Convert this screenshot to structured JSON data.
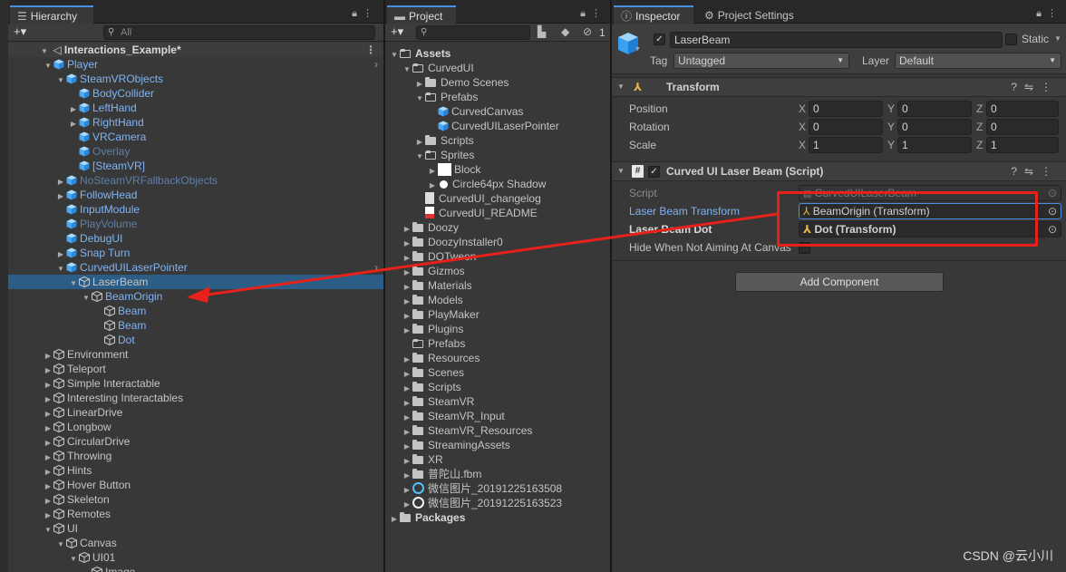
{
  "hierarchy": {
    "tab_title": "Hierarchy",
    "search_placeholder": "All",
    "add_label": "+▾",
    "scene_name": "Interactions_Example*",
    "rows": [
      {
        "label": "Player",
        "depth": 1,
        "tri": "open",
        "style": "blue",
        "icon": "prefab"
      },
      {
        "label": "SteamVRObjects",
        "depth": 2,
        "tri": "open",
        "style": "blue",
        "icon": "prefab"
      },
      {
        "label": "BodyCollider",
        "depth": 3,
        "tri": "",
        "style": "blue",
        "icon": "prefab"
      },
      {
        "label": "LeftHand",
        "depth": 3,
        "tri": "closed",
        "style": "blue",
        "icon": "prefab"
      },
      {
        "label": "RightHand",
        "depth": 3,
        "tri": "closed",
        "style": "blue",
        "icon": "prefab"
      },
      {
        "label": "VRCamera",
        "depth": 3,
        "tri": "",
        "style": "blue",
        "icon": "prefab"
      },
      {
        "label": "Overlay",
        "depth": 3,
        "tri": "",
        "style": "dim",
        "icon": "prefab"
      },
      {
        "label": "[SteamVR]",
        "depth": 3,
        "tri": "",
        "style": "blue",
        "icon": "prefab"
      },
      {
        "label": "NoSteamVRFallbackObjects",
        "depth": 2,
        "tri": "closed",
        "style": "dim",
        "icon": "prefab"
      },
      {
        "label": "FollowHead",
        "depth": 2,
        "tri": "closed",
        "style": "blue",
        "icon": "prefab"
      },
      {
        "label": "InputModule",
        "depth": 2,
        "tri": "",
        "style": "blue",
        "icon": "prefab"
      },
      {
        "label": "PlayVolume",
        "depth": 2,
        "tri": "",
        "style": "dim",
        "icon": "prefab"
      },
      {
        "label": "DebugUI",
        "depth": 2,
        "tri": "",
        "style": "blue",
        "icon": "prefab"
      },
      {
        "label": "Snap Turn",
        "depth": 2,
        "tri": "closed",
        "style": "blue",
        "icon": "prefab"
      },
      {
        "label": "CurvedUILaserPointer",
        "depth": 2,
        "tri": "open",
        "style": "blue",
        "icon": "prefab"
      },
      {
        "label": "LaserBeam",
        "depth": 3,
        "tri": "open",
        "style": "lbl",
        "icon": "go",
        "selected": true
      },
      {
        "label": "BeamOrigin",
        "depth": 4,
        "tri": "open",
        "style": "blue",
        "icon": "go"
      },
      {
        "label": "Beam",
        "depth": 5,
        "tri": "",
        "style": "blue",
        "icon": "go"
      },
      {
        "label": "Beam",
        "depth": 5,
        "tri": "",
        "style": "blue",
        "icon": "go"
      },
      {
        "label": "Dot",
        "depth": 5,
        "tri": "",
        "style": "blue",
        "icon": "go"
      },
      {
        "label": "Environment",
        "depth": 1,
        "tri": "closed",
        "style": "lbl",
        "icon": "go"
      },
      {
        "label": "Teleport",
        "depth": 1,
        "tri": "closed",
        "style": "lbl",
        "icon": "go"
      },
      {
        "label": "Simple Interactable",
        "depth": 1,
        "tri": "closed",
        "style": "lbl",
        "icon": "go"
      },
      {
        "label": "Interesting Interactables",
        "depth": 1,
        "tri": "closed",
        "style": "lbl",
        "icon": "go"
      },
      {
        "label": "LinearDrive",
        "depth": 1,
        "tri": "closed",
        "style": "lbl",
        "icon": "go"
      },
      {
        "label": "Longbow",
        "depth": 1,
        "tri": "closed",
        "style": "lbl",
        "icon": "go"
      },
      {
        "label": "CircularDrive",
        "depth": 1,
        "tri": "closed",
        "style": "lbl",
        "icon": "go"
      },
      {
        "label": "Throwing",
        "depth": 1,
        "tri": "closed",
        "style": "lbl",
        "icon": "go"
      },
      {
        "label": "Hints",
        "depth": 1,
        "tri": "closed",
        "style": "lbl",
        "icon": "go"
      },
      {
        "label": "Hover Button",
        "depth": 1,
        "tri": "closed",
        "style": "lbl",
        "icon": "go"
      },
      {
        "label": "Skeleton",
        "depth": 1,
        "tri": "closed",
        "style": "lbl",
        "icon": "go"
      },
      {
        "label": "Remotes",
        "depth": 1,
        "tri": "closed",
        "style": "lbl",
        "icon": "go"
      },
      {
        "label": "UI",
        "depth": 1,
        "tri": "open",
        "style": "lbl",
        "icon": "go"
      },
      {
        "label": "Canvas",
        "depth": 2,
        "tri": "open",
        "style": "lbl",
        "icon": "go"
      },
      {
        "label": "UI01",
        "depth": 3,
        "tri": "open",
        "style": "lbl",
        "icon": "go"
      },
      {
        "label": "Image",
        "depth": 4,
        "tri": "",
        "style": "lbl",
        "icon": "go"
      }
    ]
  },
  "project": {
    "tab_title": "Project",
    "add_label": "+▾",
    "hidden_count": "1",
    "rows": [
      {
        "label": "Assets",
        "depth": 0,
        "tri": "open",
        "icon": "folder-open",
        "bold": true
      },
      {
        "label": "CurvedUI",
        "depth": 1,
        "tri": "open",
        "icon": "folder-open"
      },
      {
        "label": "Demo Scenes",
        "depth": 2,
        "tri": "closed",
        "icon": "folder"
      },
      {
        "label": "Prefabs",
        "depth": 2,
        "tri": "open",
        "icon": "folder-open"
      },
      {
        "label": "CurvedCanvas",
        "depth": 3,
        "tri": "",
        "icon": "prefab"
      },
      {
        "label": "CurvedUILaserPointer",
        "depth": 3,
        "tri": "",
        "icon": "prefab"
      },
      {
        "label": "Scripts",
        "depth": 2,
        "tri": "closed",
        "icon": "folder"
      },
      {
        "label": "Sprites",
        "depth": 2,
        "tri": "open",
        "icon": "folder-open"
      },
      {
        "label": "Block",
        "depth": 3,
        "tri": "closed",
        "icon": "white-square"
      },
      {
        "label": "Circle64px Shadow",
        "depth": 3,
        "tri": "closed",
        "icon": "white-dot"
      },
      {
        "label": "CurvedUI_changelog",
        "depth": 2,
        "tri": "",
        "icon": "doc"
      },
      {
        "label": "CurvedUI_README",
        "depth": 2,
        "tri": "",
        "icon": "pdf"
      },
      {
        "label": "Doozy",
        "depth": 1,
        "tri": "closed",
        "icon": "folder"
      },
      {
        "label": "DoozyInstaller0",
        "depth": 1,
        "tri": "closed",
        "icon": "folder"
      },
      {
        "label": "DOTween",
        "depth": 1,
        "tri": "closed",
        "icon": "folder"
      },
      {
        "label": "Gizmos",
        "depth": 1,
        "tri": "closed",
        "icon": "folder"
      },
      {
        "label": "Materials",
        "depth": 1,
        "tri": "closed",
        "icon": "folder"
      },
      {
        "label": "Models",
        "depth": 1,
        "tri": "closed",
        "icon": "folder"
      },
      {
        "label": "PlayMaker",
        "depth": 1,
        "tri": "closed",
        "icon": "folder"
      },
      {
        "label": "Plugins",
        "depth": 1,
        "tri": "closed",
        "icon": "folder"
      },
      {
        "label": "Prefabs",
        "depth": 1,
        "tri": "",
        "icon": "folder-open"
      },
      {
        "label": "Resources",
        "depth": 1,
        "tri": "closed",
        "icon": "folder"
      },
      {
        "label": "Scenes",
        "depth": 1,
        "tri": "closed",
        "icon": "folder"
      },
      {
        "label": "Scripts",
        "depth": 1,
        "tri": "closed",
        "icon": "folder"
      },
      {
        "label": "SteamVR",
        "depth": 1,
        "tri": "closed",
        "icon": "folder"
      },
      {
        "label": "SteamVR_Input",
        "depth": 1,
        "tri": "closed",
        "icon": "folder"
      },
      {
        "label": "SteamVR_Resources",
        "depth": 1,
        "tri": "closed",
        "icon": "folder"
      },
      {
        "label": "StreamingAssets",
        "depth": 1,
        "tri": "closed",
        "icon": "folder"
      },
      {
        "label": "XR",
        "depth": 1,
        "tri": "closed",
        "icon": "folder"
      },
      {
        "label": "普陀山.fbm",
        "depth": 1,
        "tri": "closed",
        "icon": "folder"
      },
      {
        "label": "微信图片_20191225163508",
        "depth": 1,
        "tri": "closed",
        "icon": "ring-blue"
      },
      {
        "label": "微信图片_20191225163523",
        "depth": 1,
        "tri": "closed",
        "icon": "ring-white"
      },
      {
        "label": "Packages",
        "depth": 0,
        "tri": "closed",
        "icon": "folder",
        "bold": true
      }
    ]
  },
  "inspector": {
    "tab_title": "Inspector",
    "tab2_title": "Project Settings",
    "object_name": "LaserBeam",
    "static_label": "Static",
    "tag_label": "Tag",
    "tag_value": "Untagged",
    "layer_label": "Layer",
    "layer_value": "Default",
    "transform": {
      "title": "Transform",
      "rows": [
        {
          "label": "Position",
          "x": "0",
          "y": "0",
          "z": "0"
        },
        {
          "label": "Rotation",
          "x": "0",
          "y": "0",
          "z": "0"
        },
        {
          "label": "Scale",
          "x": "1",
          "y": "1",
          "z": "1"
        }
      ],
      "axis_x": "X",
      "axis_y": "Y",
      "axis_z": "Z"
    },
    "script_component": {
      "title": "Curved UI Laser Beam (Script)",
      "script_label": "Script",
      "script_value": "CurvedUILaserBeam",
      "laser_transform_label": "Laser Beam Transform",
      "laser_transform_value": "BeamOrigin (Transform)",
      "laser_dot_label": "Laser Beam Dot",
      "laser_dot_value": "Dot (Transform)",
      "hide_label": "Hide When Not Aiming At Canvas"
    },
    "add_component_label": "Add Component"
  },
  "watermark": "CSDN @云小川",
  "colors": {
    "accent": "#4a8fe0",
    "selection": "#2c5d87",
    "annotation": "#e8211b",
    "prefab": "#7fb4f5"
  }
}
